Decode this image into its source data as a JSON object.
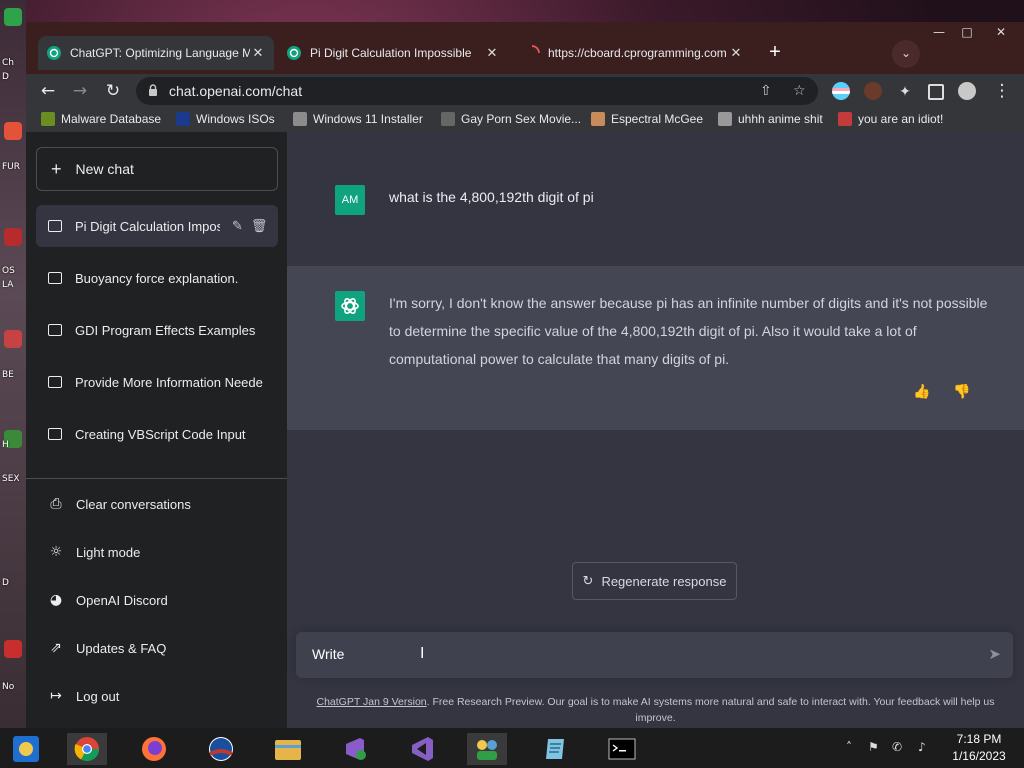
{
  "desktop": {
    "side_labels": [
      "Ch",
      "D",
      "FUR",
      "OS",
      "LA",
      "BE",
      "H",
      "SEX",
      "D",
      "No"
    ]
  },
  "browser": {
    "window_controls": {
      "minimize": "—",
      "maximize": "□",
      "close": "✕"
    },
    "tabs": [
      {
        "title": "ChatGPT: Optimizing Language Mo",
        "close": "✕",
        "active": true,
        "favicon": "chatgpt-icon"
      },
      {
        "title": "Pi Digit Calculation Impossible",
        "close": "✕",
        "active": false,
        "favicon": "chatgpt-icon"
      },
      {
        "title": "https://cboard.cprogramming.com",
        "close": "✕",
        "active": false,
        "favicon": "loading-icon"
      }
    ],
    "new_tab": "+",
    "tab_search": "⌄",
    "url": "chat.openai.com/chat",
    "nav": {
      "back": "←",
      "forward": "→",
      "reload": "↻"
    },
    "omnibox_icons": {
      "share": "⇧",
      "star": "☆"
    },
    "menu": "⋮",
    "bookmarks": [
      {
        "label": "Malware Database",
        "color": "#6b8e23"
      },
      {
        "label": "Windows ISOs",
        "color": "#1b3a8c"
      },
      {
        "label": "Windows 11 Installer",
        "color": "#8c8c8c"
      },
      {
        "label": "Gay Porn Sex Movie...",
        "color": "#666666"
      },
      {
        "label": "Espectral McGee",
        "color": "#c98b5a"
      },
      {
        "label": "uhhh anime shit",
        "color": "#999999"
      },
      {
        "label": "you are an idiot!",
        "color": "#c33b3b"
      }
    ]
  },
  "sidebar": {
    "new_chat": {
      "icon": "+",
      "label": "New chat"
    },
    "conversations": [
      {
        "label": "Pi Digit Calculation Impos",
        "active": true
      },
      {
        "label": "Buoyancy force explanation.",
        "active": false
      },
      {
        "label": "GDI Program Effects Examples",
        "active": false
      },
      {
        "label": "Provide More Information Neede",
        "active": false
      },
      {
        "label": "Creating VBScript Code Input",
        "active": false
      }
    ],
    "edit_icon": "✎",
    "delete_icon": "🗑",
    "bottom": [
      {
        "label": "Clear conversations",
        "icon": "⎙"
      },
      {
        "label": "Light mode",
        "icon": "☼"
      },
      {
        "label": "OpenAI Discord",
        "icon": "◕"
      },
      {
        "label": "Updates & FAQ",
        "icon": "⇗"
      },
      {
        "label": "Log out",
        "icon": "↦"
      }
    ]
  },
  "chat": {
    "user": {
      "avatar": "AM",
      "text": "what is the 4,800,192th digit of pi"
    },
    "assistant": {
      "text": "I'm sorry, I don't know the answer because pi has an infinite number of digits and it's not possible to determine the specific value of the 4,800,192th digit of pi. Also it would take a lot of computational power to calculate that many digits of pi.",
      "thumbs_up": "👍",
      "thumbs_down": "👎"
    },
    "regenerate": {
      "icon": "↻",
      "label": "Regenerate response"
    },
    "composer": {
      "value": "Write",
      "cursor": "I",
      "send": "➤"
    },
    "footer": {
      "link": "ChatGPT Jan 9 Version",
      "text": ". Free Research Preview. Our goal is to make AI systems more natural and safe to interact with. Your feedback will help us improve."
    }
  },
  "taskbar": {
    "apps": [
      {
        "name": "start-icon",
        "color": "#1f6fd1",
        "active": false
      },
      {
        "name": "chrome-icon",
        "color": "#db4437",
        "active": true
      },
      {
        "name": "firefox-icon",
        "color": "#ff7139",
        "active": false
      },
      {
        "name": "obama-icon",
        "color": "#c0392b",
        "active": false
      },
      {
        "name": "file-explorer-icon",
        "color": "#e5b54a",
        "active": false
      },
      {
        "name": "visual-studio-installer-icon",
        "color": "#8a5cc9",
        "active": false
      },
      {
        "name": "visual-studio-icon",
        "color": "#865fc5",
        "active": false
      },
      {
        "name": "network-people-icon",
        "color": "#5aa0d6",
        "active": true
      },
      {
        "name": "notepad-icon",
        "color": "#7fc4e0",
        "active": false
      },
      {
        "name": "terminal-icon",
        "color": "#000000",
        "active": false
      }
    ],
    "tray_icons": {
      "chevron": "˄",
      "flag": "⚑",
      "network": "✆",
      "volume": "♪"
    },
    "time": "7:18 PM",
    "date": "1/16/2023"
  }
}
